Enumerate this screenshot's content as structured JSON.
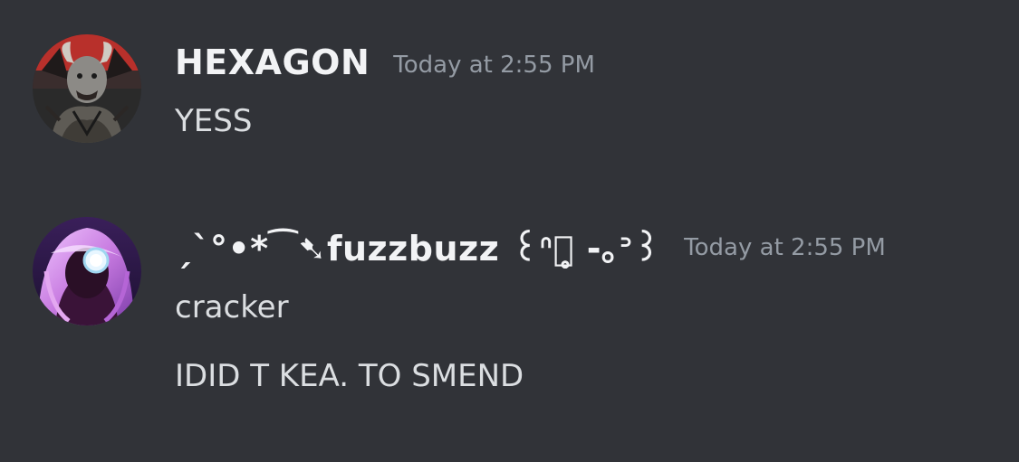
{
  "colors": {
    "background": "#313338",
    "username": "#f2f3f5",
    "timestamp": "#949ba4",
    "message_text": "#dbdee1"
  },
  "messages": [
    {
      "username": "HEXAGON",
      "timestamp": "Today at 2:55 PM",
      "avatar_icon": "demon-figure-avatar",
      "lines": [
        "YESS"
      ]
    },
    {
      "username": "ˏˋ°•*⁀➷fuzzbuzz ꒰ᐢつ̥̥ -｡ᐣ꒱",
      "timestamp": "Today at 2:55 PM",
      "avatar_icon": "pink-haired-robot-avatar",
      "lines": [
        "cracker",
        "IDID T KEA. TO SMEND"
      ]
    }
  ]
}
